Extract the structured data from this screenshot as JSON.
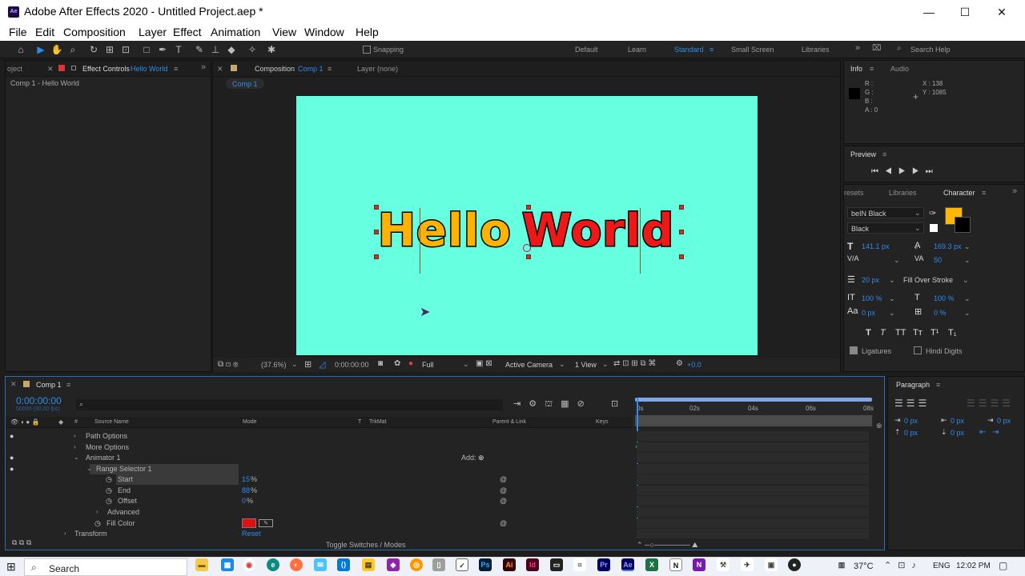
{
  "window": {
    "title": "Adobe After Effects 2020 - Untitled Project.aep *",
    "app_icon": "Ae",
    "minimize": "—",
    "maximize": "☐",
    "close": "✕"
  },
  "menu": [
    "File",
    "Edit",
    "Composition",
    "Layer",
    "Effect",
    "Animation",
    "View",
    "Window",
    "Help"
  ],
  "toolbar": {
    "snapping": "Snapping",
    "workspaces": [
      "Default",
      "Learn",
      "Standard",
      "Small Screen",
      "Libraries"
    ],
    "search_placeholder": "Search Help"
  },
  "left_panel": {
    "tab_project": "oject",
    "tab_effect_controls": "Effect Controls",
    "tab_effect_layer": "Hello World",
    "subtitle": "Comp 1 - Hello World"
  },
  "comp_panel": {
    "tab_label": "Composition",
    "tab_comp": "Comp 1",
    "layer_tab": "Layer (none)",
    "comp_button": "Comp 1",
    "text_part1": "Hello",
    "text_part2": "World",
    "zoom": "(37.6%)",
    "timecode": "0:00:00:00",
    "resolution": "Full",
    "camera": "Active Camera",
    "view": "1 View",
    "exposure": "+0.0"
  },
  "info_panel": {
    "tab": "Info",
    "tab2": "Audio",
    "r": "R :",
    "g": "G :",
    "b": "B :",
    "a": "A : 0",
    "x": "X : 138",
    "y": "Y : 1085"
  },
  "preview_panel": {
    "title": "Preview"
  },
  "character_panel": {
    "tab_presets": "resets",
    "tab_libraries": "Libraries",
    "tab_character": "Character",
    "font": "beIN Black",
    "style": "Black",
    "size": "141.1 px",
    "leading": "169.3 px",
    "tracking": "50",
    "stroke": "20 px",
    "stroke_mode": "Fill Over Stroke",
    "v_scale": "100 %",
    "h_scale": "100 %",
    "baseline": "0 px",
    "tsume": "0 %",
    "ligatures": "Ligatures",
    "hindi": "Hindi Digits",
    "fill_color": "#ffb800",
    "styles": [
      "T",
      "T",
      "TT",
      "Tт",
      "T¹",
      "T₁"
    ]
  },
  "paragraph_panel": {
    "title": "Paragraph",
    "vals": [
      "0 px",
      "0 px",
      "0 px",
      "0 px",
      "0 px"
    ]
  },
  "timeline": {
    "comp_tab": "Comp 1",
    "timecode": "0:00:00:00",
    "fps": "00000 (30.00 fps)",
    "cols": {
      "source": "Source Name",
      "mode": "Mode",
      "t": "T",
      "trkmat": "TrkMat",
      "parent": "Parent & Link",
      "keys": "Keys"
    },
    "rows": [
      {
        "label": "Path Options"
      },
      {
        "label": "More Options"
      },
      {
        "label": "Animator 1",
        "extra": "Add:"
      },
      {
        "label": "Range Selector 1"
      },
      {
        "label": "Start",
        "value": "15",
        "unit": "%"
      },
      {
        "label": "End",
        "value": "88",
        "unit": "%"
      },
      {
        "label": "Offset",
        "value": "0",
        "unit": "%"
      },
      {
        "label": "Advanced"
      },
      {
        "label": "Fill Color"
      },
      {
        "label": "Transform",
        "value": "Reset"
      }
    ],
    "ruler": [
      "0s",
      "02s",
      "04s",
      "06s",
      "08s"
    ],
    "toggle": "Toggle Switches / Modes"
  },
  "taskbar": {
    "search": "Search",
    "temp": "37°C",
    "lang": "ENG",
    "time": "12:02 PM"
  }
}
